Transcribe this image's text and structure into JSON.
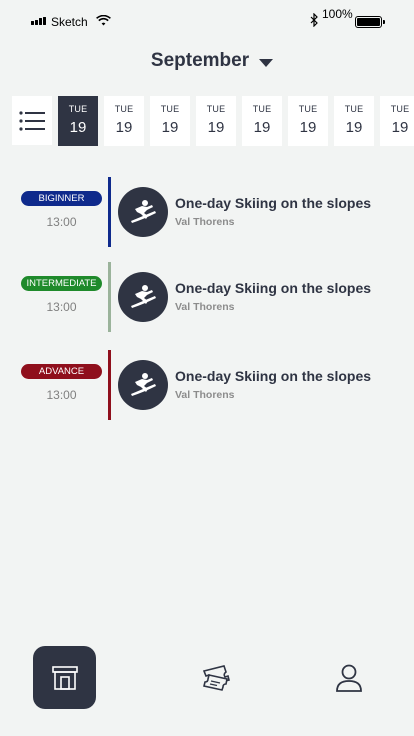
{
  "status_bar": {
    "carrier": "Sketch",
    "battery_text": "100%",
    "icons": [
      "signal-icon",
      "wifi-icon",
      "bluetooth-icon",
      "battery-icon"
    ]
  },
  "header": {
    "month": "September",
    "dropdown_icon": "caret-down-icon"
  },
  "date_strip": {
    "list_icon": "list-icon",
    "days": [
      {
        "dow": "TUE",
        "num": "19",
        "selected": true
      },
      {
        "dow": "TUE",
        "num": "19",
        "selected": false
      },
      {
        "dow": "TUE",
        "num": "19",
        "selected": false
      },
      {
        "dow": "TUE",
        "num": "19",
        "selected": false
      },
      {
        "dow": "TUE",
        "num": "19",
        "selected": false
      },
      {
        "dow": "TUE",
        "num": "19",
        "selected": false
      },
      {
        "dow": "TUE",
        "num": "19",
        "selected": false
      },
      {
        "dow": "TUE",
        "num": "19",
        "selected": false
      }
    ]
  },
  "lessons": [
    {
      "level": "BIGINNER",
      "level_color": "#0f2a8c",
      "time": "13:00",
      "title": "One-day Skiing on the slopes",
      "location": "Val Thorens",
      "icon": "snowboard-icon"
    },
    {
      "level": "INTERMEDIATE",
      "level_color": "#1f8a2b",
      "accent_color": "#9bb39b",
      "time": "13:00",
      "title": "One-day Skiing on the slopes",
      "location": "Val Thorens",
      "icon": "snowboard-icon"
    },
    {
      "level": "ADVANCE",
      "level_color": "#8f0f1c",
      "time": "13:00",
      "title": "One-day Skiing on the slopes",
      "location": "Val Thorens",
      "icon": "snowboard-icon"
    }
  ],
  "bottom_nav": {
    "items": [
      {
        "icon": "store-icon",
        "active": true
      },
      {
        "icon": "tickets-icon",
        "active": false
      },
      {
        "icon": "profile-icon",
        "active": false
      }
    ],
    "active_color": "#2f3443"
  }
}
